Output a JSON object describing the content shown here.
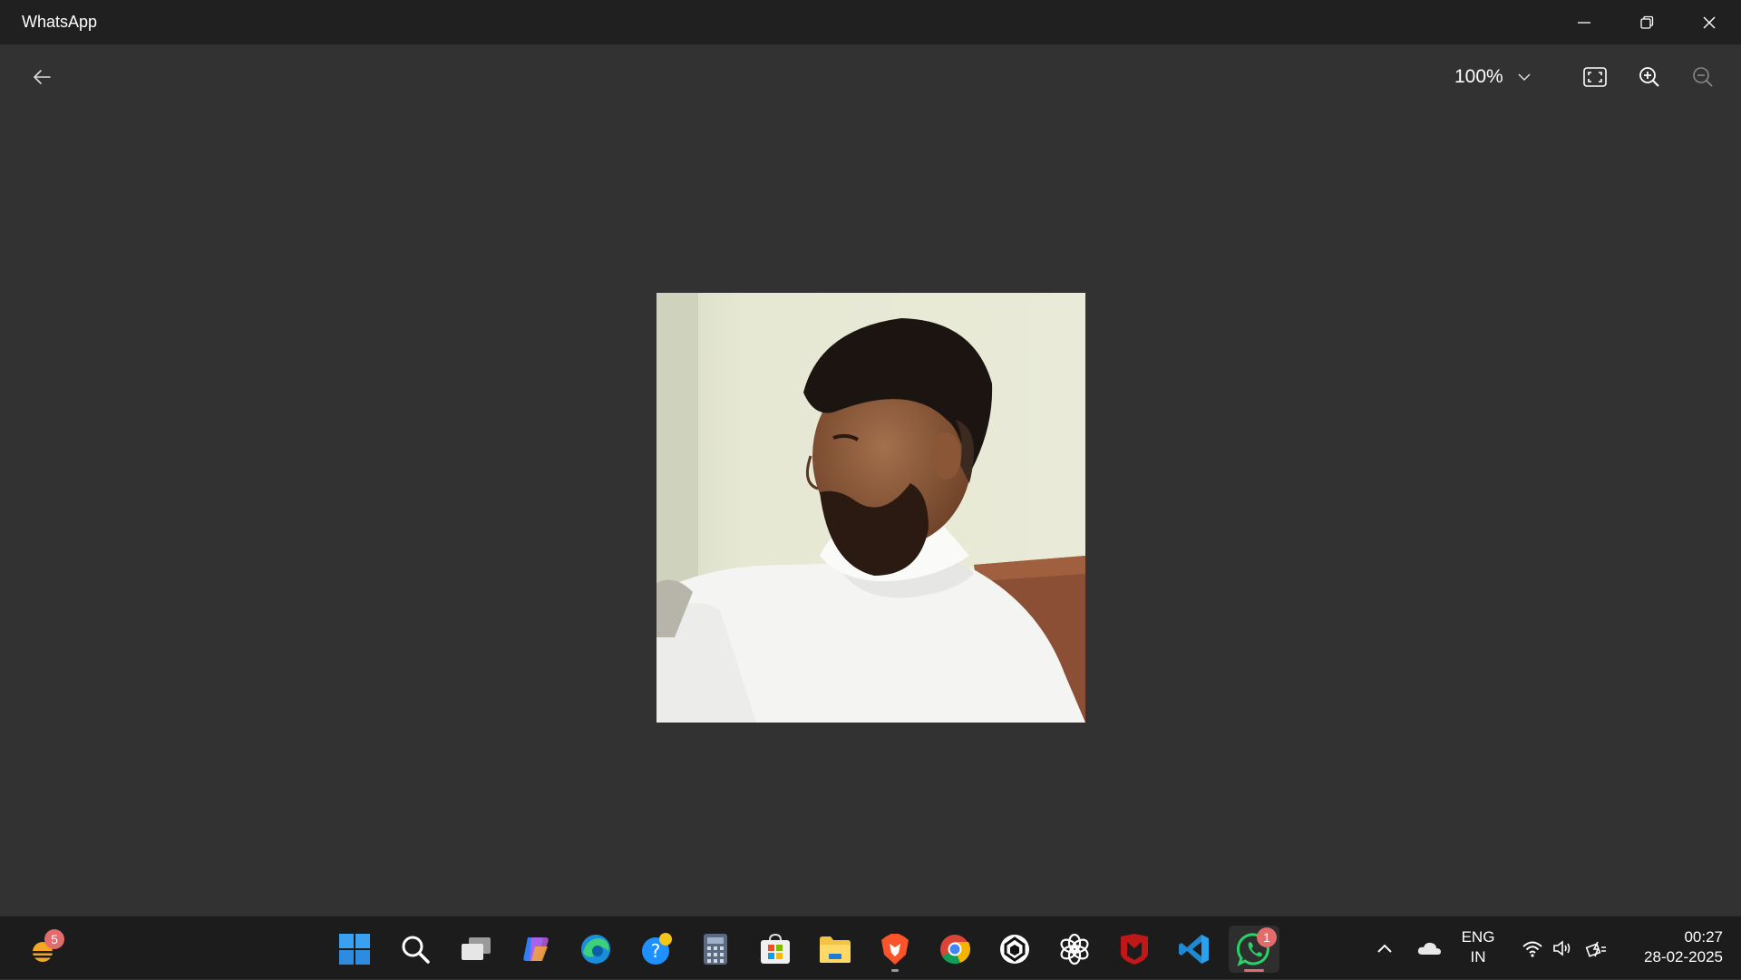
{
  "window": {
    "title": "WhatsApp"
  },
  "viewer": {
    "zoom_level": "100%",
    "image_alt": "Profile photo"
  },
  "taskbar": {
    "widgets_badge": "5",
    "whatsapp_badge": "1",
    "apps": [
      "search-icon",
      "task-view-icon",
      "copilot-icon",
      "edge-icon",
      "help-icon",
      "calculator-icon",
      "store-icon",
      "file-explorer-icon",
      "brave-icon",
      "chrome-icon",
      "openai-app-icon",
      "chatgpt-icon",
      "mcafee-icon",
      "vscode-icon",
      "whatsapp-icon"
    ]
  },
  "tray": {
    "lang_line1": "ENG",
    "lang_line2": "IN",
    "time": "00:27",
    "date": "28-02-2025"
  },
  "colors": {
    "titlebar": "#202020",
    "viewer_bg": "#323232",
    "taskbar": "#1c1c1c",
    "badge": "#e26b6b",
    "whatsapp_green": "#25d366"
  }
}
